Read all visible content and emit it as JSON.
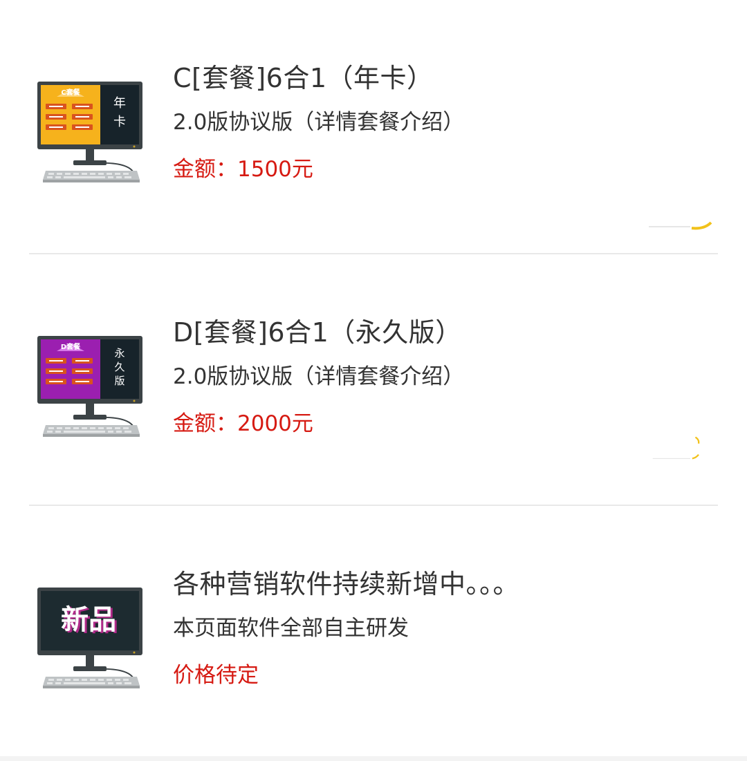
{
  "items": [
    {
      "title": "C[套餐]6合1（年卡）",
      "subtitle": "2.0版协议版（详情套餐介绍）",
      "price": "金额：1500元",
      "thumb": {
        "screen_color": "#f6b21c",
        "banner": "C套餐",
        "side_text": [
          "年",
          "卡"
        ]
      }
    },
    {
      "title": "D[套餐]6合1（永久版）",
      "subtitle": "2.0版协议版（详情套餐介绍）",
      "price": "金额：2000元",
      "thumb": {
        "screen_color": "#9b1fb0",
        "banner": "D套餐",
        "side_text": [
          "永",
          "久",
          "版"
        ]
      }
    },
    {
      "title": "各种营销软件持续新增中。。。",
      "subtitle": "本页面软件全部自主研发",
      "price": "价格待定",
      "thumb": {
        "screen_color": "#1d2b30",
        "banner": "新品",
        "side_text": []
      }
    }
  ],
  "colors": {
    "title": "#333333",
    "price": "#d61a12",
    "divider": "#e8e8e8",
    "monitor_frame": "#3c4346"
  },
  "icons": [
    "computer-monitor-icon",
    "keyboard-icon"
  ]
}
